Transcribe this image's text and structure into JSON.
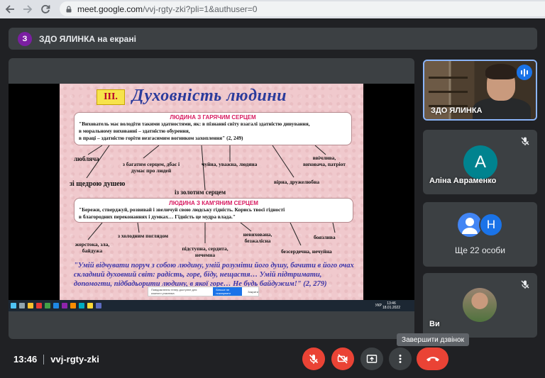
{
  "browser": {
    "url_host": "meet.google.com",
    "url_path": "/vvj-rgty-zki?pli=1&authuser=0"
  },
  "presenter": {
    "avatar_letter": "З",
    "label": "ЗДО ЯЛИНКА на екрані"
  },
  "slide": {
    "number": "III.",
    "title": "Духовність людини",
    "box1_heading": "ЛЮДИНА З ГАРЯЧИМ СЕРЦЕМ",
    "box1_line1": "\"Вихователь має володіти такими здатностями, як: в пізнанні світу взагалі   здатністю дивування,",
    "box1_line2": "в моральному вихованні – здатністю обурення,",
    "box1_line3": "в праці – здатністю горіти незгасимим вогником захоплення\" (2, 249)",
    "warm": [
      "любляча",
      "з багатим серцем, дбає і думає про людей",
      "чуйна, уважна, людяна",
      "ввічлива, виховача, патріот",
      "зі щедрою душею",
      "вірна, дружелюбна",
      "із золотим серцем"
    ],
    "box2_heading": "ЛЮДИНА З КАМ'ЯНИМ СЕРЦЕМ",
    "box2_line1": "\"Бережи, стверджуй, розвивай і звеличуй свою людську гідність. Корись твоєї гідності",
    "box2_line2": "в благородних переконаннях і думках… Гідність    це мудра влада.\"",
    "cold": [
      "жорстока, зла, байдужа",
      "з холодним поглядом",
      "підступна, сердита, нечемна",
      "невихована, безжалісна",
      "боязлива",
      "безсердечна, нечуйна"
    ],
    "quote": "\"Умій відчувати поруч з собою людину, умій розуміти його душу, бачити в його очах складний духовний світ:  радість, горе, біду, нещастя… Умій підтримати, допомогти, підбадьорити людину, в якої горе… Не будь байдужим!\" (2, 279)",
    "notify_text": "Повідомлення тепер доступне для кожного учасника",
    "notify_button": "Більше не показувати",
    "notify_close": "Закрити",
    "tray_time": "13:46",
    "tray_date": "18.01.2022",
    "tray_lang": "УКР"
  },
  "tiles": {
    "self_name": "ЗДО ЯЛИНКА",
    "aline_letter": "A",
    "aline_name": "Аліна Авраменко",
    "group_letter": "Н",
    "group_label": "Ще 22 особи",
    "you_name": "Ви"
  },
  "tooltip": "Завершити дзвінок",
  "footer": {
    "time": "13:46",
    "code": "vvj-rgty-zki"
  },
  "colors": {
    "meet_bg": "#202124",
    "tile_bg": "#3c4043",
    "danger": "#ea4335",
    "accent": "#1a73e8"
  }
}
